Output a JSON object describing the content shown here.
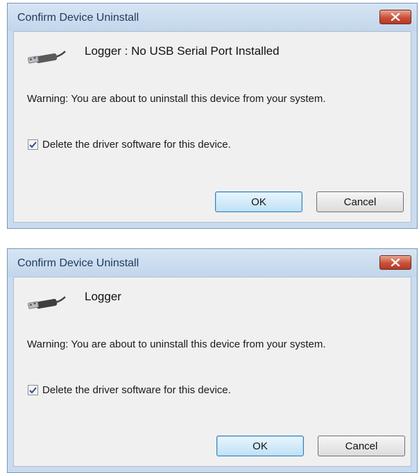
{
  "dialogs": [
    {
      "title": "Confirm Device Uninstall",
      "close_icon": "close-icon",
      "device_icon": "usb-cable-icon",
      "device_name": "Logger : No USB Serial Port Installed",
      "warning": "Warning: You are about to uninstall this device from your system.",
      "checkbox_label": "Delete the driver software for this device.",
      "checkbox_checked": true,
      "ok_label": "OK",
      "cancel_label": "Cancel"
    },
    {
      "title": "Confirm Device Uninstall",
      "close_icon": "close-icon",
      "device_icon": "usb-cable-icon",
      "device_name": "Logger",
      "warning": "Warning: You are about to uninstall this device from your system.",
      "checkbox_label": "Delete the driver software for this device.",
      "checkbox_checked": true,
      "ok_label": "OK",
      "cancel_label": "Cancel"
    }
  ],
  "colors": {
    "frame": "#c9dcef",
    "client": "#f0f0f0",
    "close_button": "#c9503a",
    "ok_border": "#3c7fb1"
  }
}
